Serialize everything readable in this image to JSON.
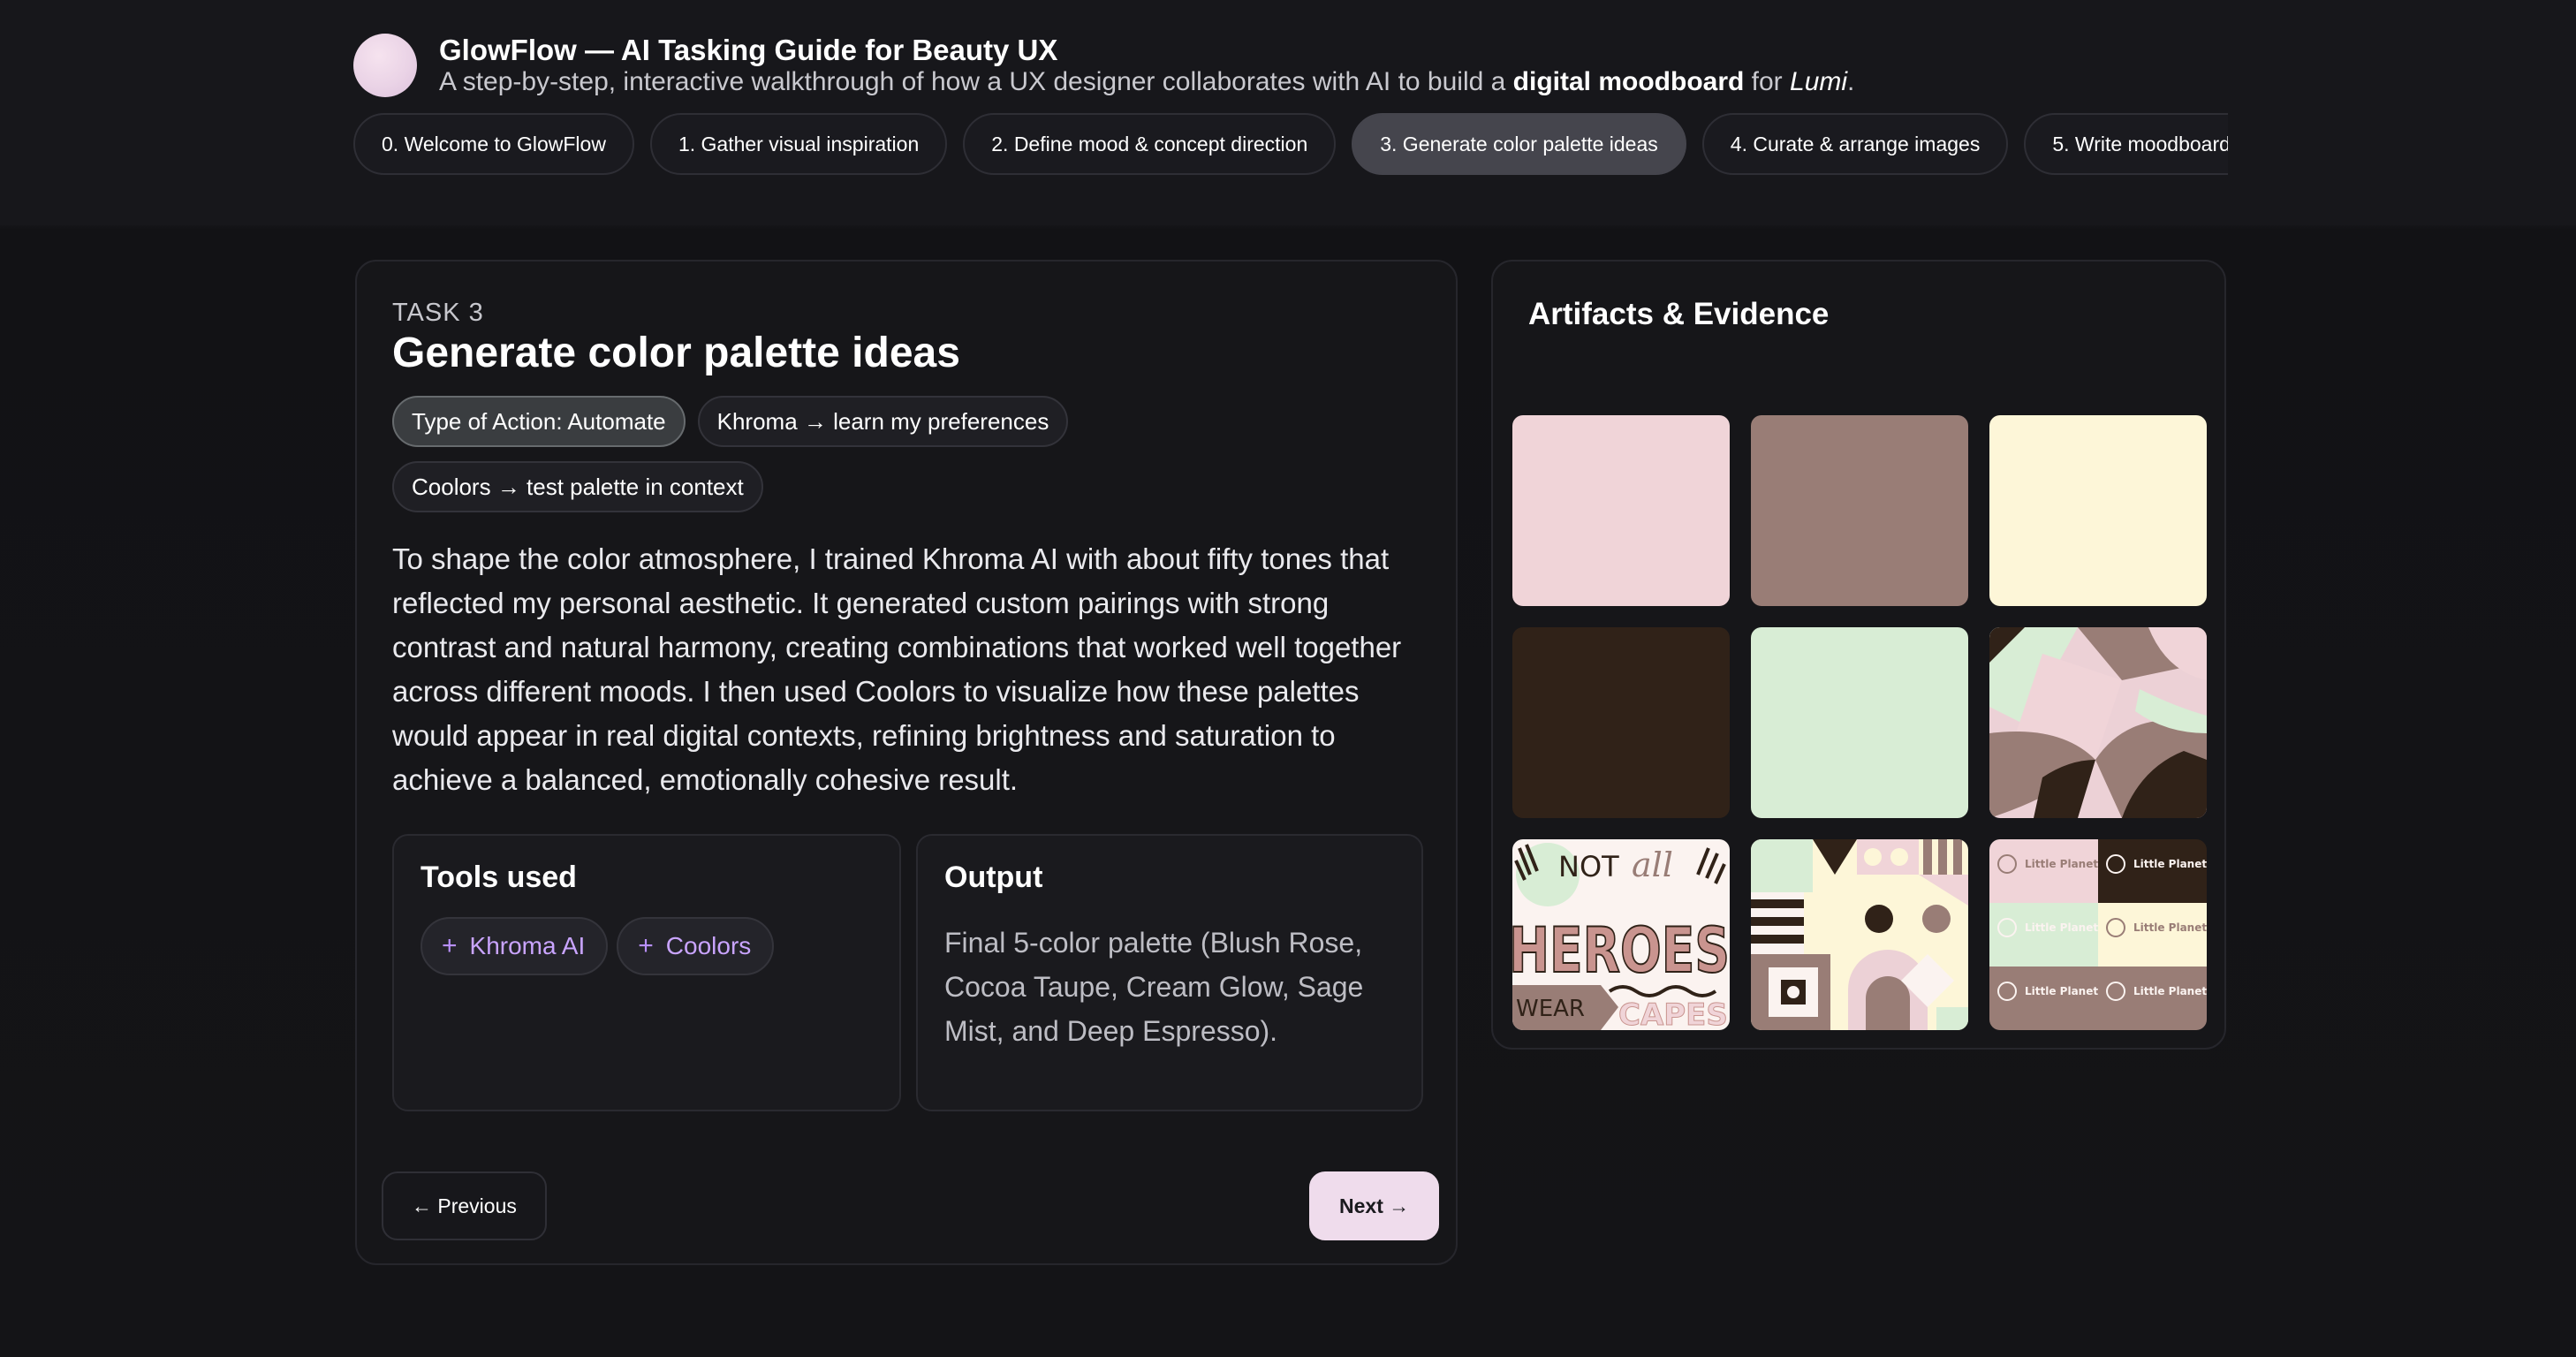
{
  "header": {
    "title": "GlowFlow — AI Tasking Guide for Beauty UX",
    "subtitle_pre": "A step-by-step, interactive walkthrough of how a UX designer collaborates with AI to build a ",
    "subtitle_bold": "digital moodboard",
    "subtitle_mid": " for ",
    "subtitle_italic": "Lumi",
    "subtitle_end": "."
  },
  "tabs": [
    {
      "label": "0. Welcome to GlowFlow"
    },
    {
      "label": "1. Gather visual inspiration"
    },
    {
      "label": "2. Define mood & concept direction"
    },
    {
      "label": "3. Generate color palette ideas",
      "active": true
    },
    {
      "label": "4. Curate & arrange images"
    },
    {
      "label": "5. Write moodboard"
    }
  ],
  "task": {
    "label": "TASK 3",
    "title": "Generate color palette ideas",
    "chips": [
      "Type of Action: Automate",
      "Khroma → learn my preferences",
      "Coolors → test palette in context"
    ],
    "description": "To shape the color atmosphere, I trained Khroma AI with about fifty tones that reflected my personal aesthetic. It generated custom pairings with strong contrast and natural harmony, creating combinations that worked well together across different moods. I then used Coolors to visualize how these palettes would appear in real digital contexts, refining brightness and saturation to achieve a balanced, emotionally cohesive result.",
    "tools_title": "Tools used",
    "tools": [
      "Khroma AI",
      "Coolors"
    ],
    "output_title": "Output",
    "output_text": "Final 5-color palette (Blush Rose, Cocoa Taupe, Cream Glow, Sage Mist, and Deep Espresso)."
  },
  "nav": {
    "previous": "← Previous",
    "next": "Next →"
  },
  "artifacts": {
    "title": "Artifacts & Evidence",
    "swatch_colors": [
      "#f0d4d8",
      "#997d76",
      "#fdf6d8",
      "#302218",
      "#d8edd5"
    ],
    "poster_words": [
      "NOT",
      "all",
      "HEROES",
      "WEAR",
      "CAPES"
    ],
    "logo_text": "Little Planet"
  },
  "colors": {
    "accent": "#efdcec",
    "tool_text": "#c9a4ff"
  }
}
